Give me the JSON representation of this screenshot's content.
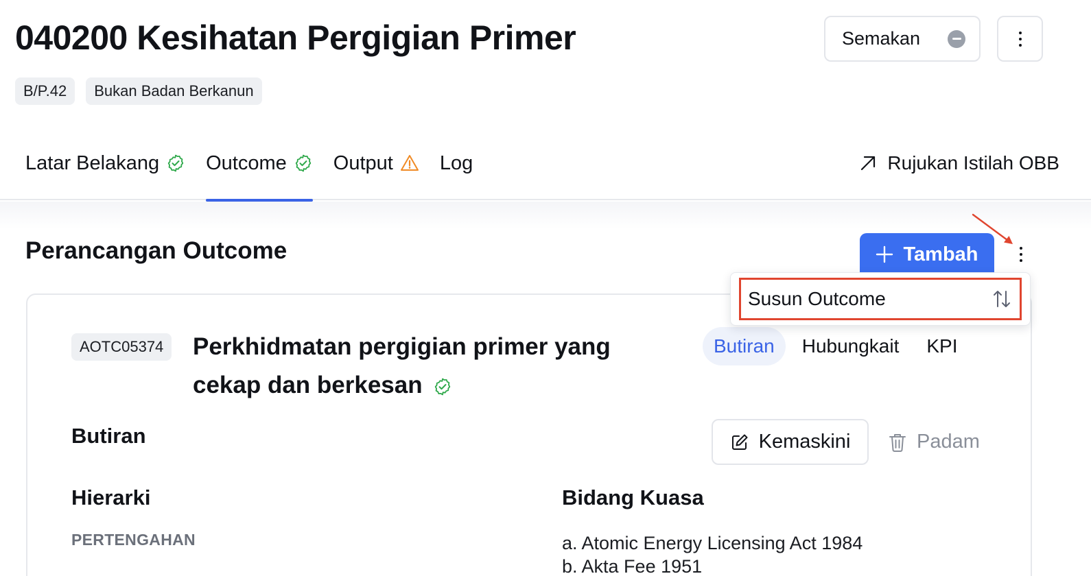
{
  "header": {
    "title": "040200 Kesihatan Pergigian Primer",
    "chips": [
      "B/P.42",
      "Bukan Badan Berkanun"
    ],
    "status_button_label": "Semakan"
  },
  "tabs": [
    {
      "label": "Latar Belakang",
      "status": "check"
    },
    {
      "label": "Outcome",
      "status": "check",
      "active": true
    },
    {
      "label": "Output",
      "status": "warning"
    },
    {
      "label": "Log",
      "status": "none"
    }
  ],
  "reference_link": "Rujukan Istilah OBB",
  "section": {
    "title": "Perancangan Outcome",
    "add_button": "Tambah"
  },
  "dropdown": {
    "items": [
      "Susun Outcome"
    ]
  },
  "card": {
    "code": "AOTC05374",
    "title": "Perkhidmatan pergigian primer yang cekap dan berkesan",
    "tabs": [
      "Butiran",
      "Hubungkait",
      "KPI"
    ],
    "active_tab": "Butiran",
    "subsection_title": "Butiran",
    "edit_button": "Kemaskini",
    "delete_button": "Padam",
    "hierarchy_label": "Hierarki",
    "hierarchy_value": "PERTENGAHAN",
    "authority_label": "Bidang Kuasa",
    "authority_items": [
      "a. Atomic Energy Licensing Act 1984",
      "b. Akta Fee 1951"
    ]
  },
  "colors": {
    "accent": "#3a63e6",
    "primary_button": "#3a6ef0",
    "success": "#2ea84a",
    "warning": "#f08a24",
    "annotation": "#e0452f"
  }
}
